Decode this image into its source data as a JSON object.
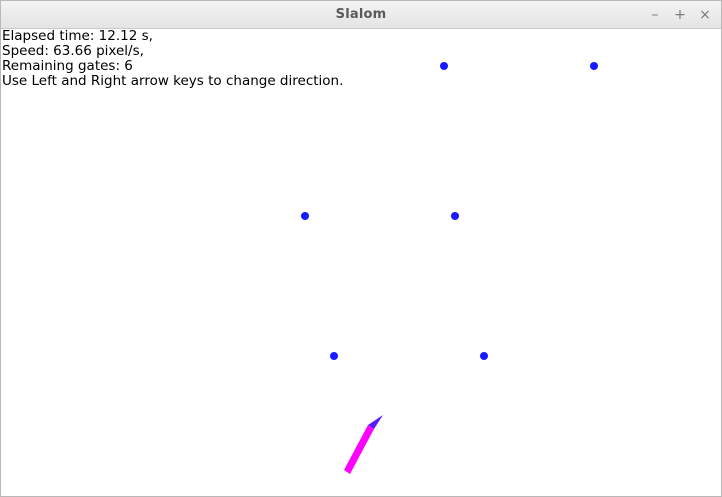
{
  "window": {
    "title": "Slalom",
    "controls": {
      "minimize": "–",
      "maximize": "+",
      "close": "×"
    }
  },
  "hud": {
    "elapsed": "Elapsed time: 12.12 s,",
    "speed": "Speed: 63.66 pixel/s,",
    "remaining": "Remaining gates: 6",
    "instructions": "Use Left and Right arrow keys to change direction."
  },
  "game": {
    "remaining_gates": 6,
    "gate_color": "#1a1aff",
    "skier_colors": {
      "body": "#ff00ff",
      "tip": "#5a1aff"
    }
  }
}
